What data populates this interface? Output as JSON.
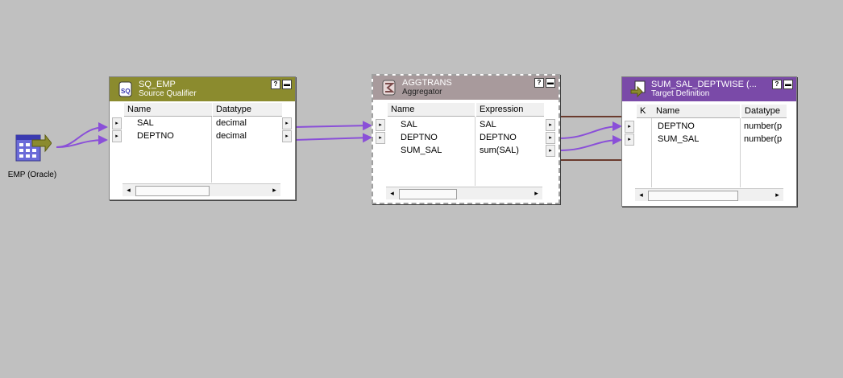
{
  "source": {
    "label": "EMP (Oracle)"
  },
  "sq": {
    "name": "SQ_EMP",
    "type": "Source Qualifier",
    "col1": "Name",
    "col2": "Datatype",
    "rows": [
      {
        "name": "SAL",
        "value": "decimal"
      },
      {
        "name": "DEPTNO",
        "value": "decimal"
      }
    ]
  },
  "agg": {
    "name": "AGGTRANS",
    "type": "Aggregator",
    "col1": "Name",
    "col2": "Expression",
    "rows": [
      {
        "name": "SAL",
        "value": "SAL"
      },
      {
        "name": "DEPTNO",
        "value": "DEPTNO"
      },
      {
        "name": "SUM_SAL",
        "value": "sum(SAL)"
      }
    ]
  },
  "target": {
    "name": "SUM_SAL_DEPTWISE (...",
    "type": "Target Definition",
    "col0": "K",
    "col1": "Name",
    "col2": "Datatype",
    "rows": [
      {
        "name": "DEPTNO",
        "value": "number(p"
      },
      {
        "name": "SUM_SAL",
        "value": "number(p"
      }
    ]
  },
  "buttons": {
    "help": "?",
    "minimize": "▬"
  },
  "colors": {
    "sq_header": "#8b8b2e",
    "agg_header": "#a89a9c",
    "target_header": "#7a4aa8",
    "link": "#8a4fd8",
    "highlight": "#6b3b2e"
  }
}
